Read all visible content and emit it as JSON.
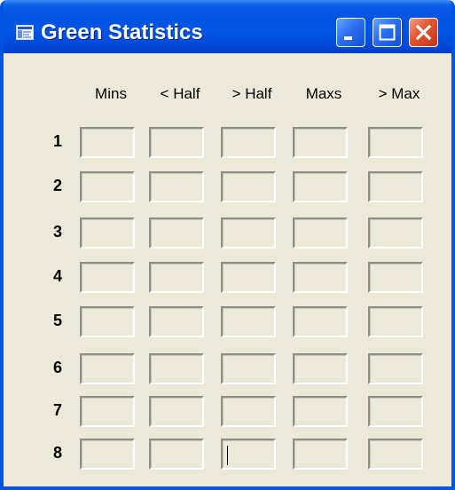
{
  "window": {
    "title": "Green Statistics",
    "icon": "app-icon",
    "controls": [
      "minimize-icon",
      "maximize-icon",
      "close-icon"
    ]
  },
  "columns": [
    "Mins",
    "< Half",
    "> Half",
    "Maxs",
    "> Max"
  ],
  "rows": [
    "1",
    "2",
    "3",
    "4",
    "5",
    "6",
    "7",
    "8"
  ],
  "cells": [
    [
      "",
      "",
      "",
      "",
      ""
    ],
    [
      "",
      "",
      "",
      "",
      ""
    ],
    [
      "",
      "",
      "",
      "",
      ""
    ],
    [
      "",
      "",
      "",
      "",
      ""
    ],
    [
      "",
      "",
      "",
      "",
      ""
    ],
    [
      "",
      "",
      "",
      "",
      ""
    ],
    [
      "",
      "",
      "",
      "",
      ""
    ],
    [
      "",
      "",
      "",
      "",
      ""
    ]
  ],
  "focused_cell": {
    "row": 8,
    "column": "> Half"
  },
  "colors": {
    "titlebar": "#0054e3",
    "face": "#ece9d8",
    "close": "#e2532f"
  }
}
